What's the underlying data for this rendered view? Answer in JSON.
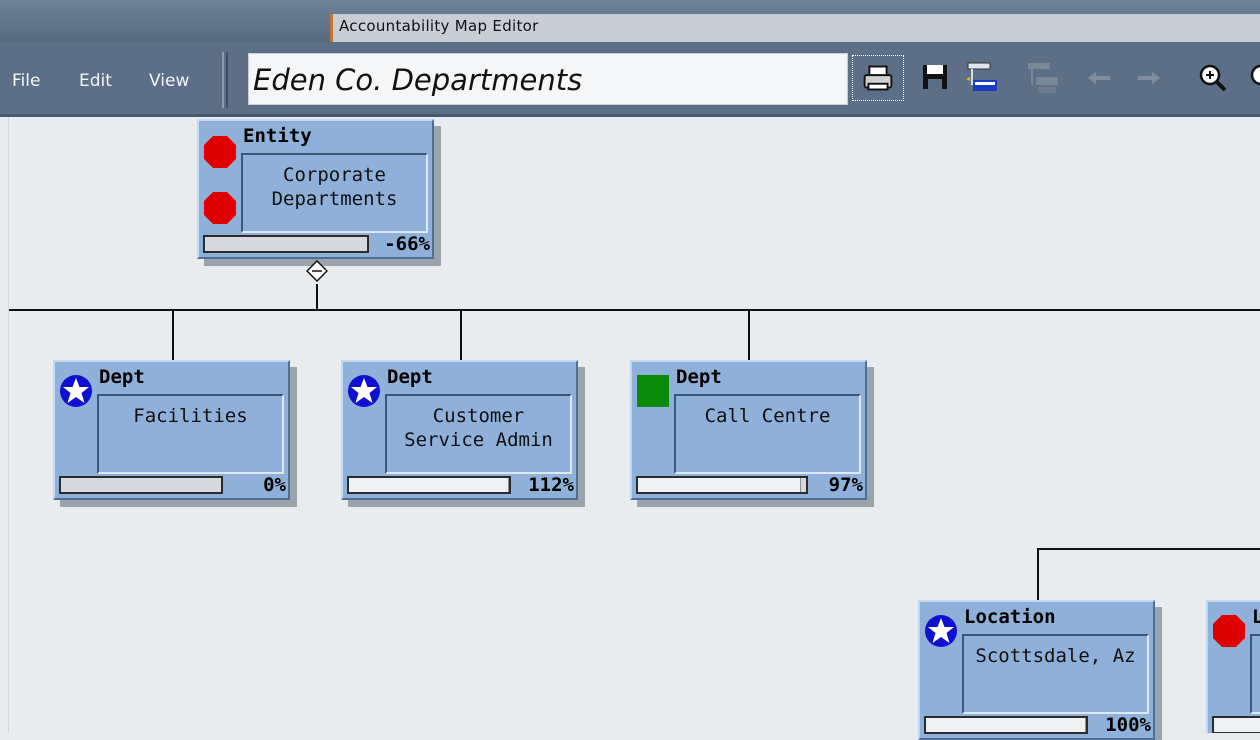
{
  "window": {
    "title": "Accountability Map Editor"
  },
  "menu": {
    "file": "File",
    "edit": "Edit",
    "view": "View"
  },
  "document": {
    "title": "Eden Co. Departments"
  },
  "toolbar": {
    "icons": [
      "print-icon",
      "save-icon",
      "add-child-icon",
      "remove-child-icon",
      "arrow-left-icon",
      "arrow-right-icon",
      "zoom-in-icon",
      "zoom-out-icon"
    ]
  },
  "nodes": {
    "entity": {
      "type": "Entity",
      "name": "Corporate Departments",
      "name_line1": "Corporate",
      "name_line2": "Departments",
      "percent": "-66%",
      "progress": 0,
      "status_icon": "red-stop-icon"
    },
    "facilities": {
      "type": "Dept",
      "name": "Facilities",
      "percent": "0%",
      "progress": 0,
      "status_icon": "star-icon"
    },
    "customer": {
      "type": "Dept",
      "name": "Customer Service Admin",
      "name_line1": "Customer",
      "name_line2": "Service Admin",
      "percent": "112%",
      "progress": 1.0,
      "status_icon": "star-icon"
    },
    "callcentre": {
      "type": "Dept",
      "name": "Call Centre",
      "percent": "97%",
      "progress": 0.97,
      "status_icon": "green-square-icon"
    },
    "scottsdale": {
      "type": "Location",
      "name": "Scottsdale, Az",
      "percent": "100%",
      "progress": 1.0,
      "status_icon": "star-icon"
    },
    "partial": {
      "type": "L",
      "status_icon": "red-stop-icon"
    }
  },
  "colors": {
    "node_fill": "#8fb0d8",
    "stop_red": "#e00000",
    "star_blue": "#1010d0",
    "status_green": "#0a8a0a",
    "accent_orange": "#c8742f"
  }
}
